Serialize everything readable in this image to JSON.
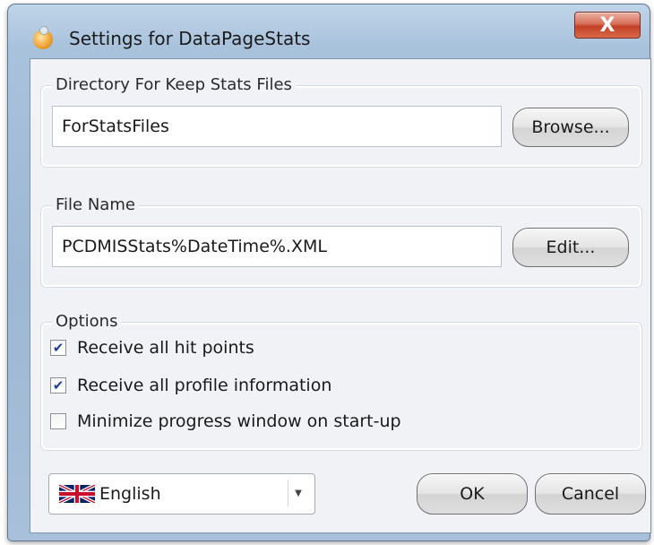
{
  "window": {
    "title": "Settings for DataPageStats",
    "close_glyph": "X"
  },
  "directory_group": {
    "legend": "Directory For Keep Stats Files",
    "value": "ForStatsFiles",
    "button_label": "Browse..."
  },
  "filename_group": {
    "legend": "File Name",
    "value": "PCDMISStats%DateTime%.XML",
    "button_label": "Edit..."
  },
  "options_group": {
    "legend": "Options",
    "items": [
      {
        "label": "Receive all hit points",
        "checked": true
      },
      {
        "label": "Receive all profile information",
        "checked": true
      },
      {
        "label": "Minimize progress window on start-up",
        "checked": false
      }
    ]
  },
  "footer": {
    "language_selected": "English",
    "flag_icon": "uk-flag-icon",
    "ok_label": "OK",
    "cancel_label": "Cancel"
  },
  "colors": {
    "close_button": "#c24026",
    "checkmark": "#21418f",
    "frame": "#a9c2dc"
  }
}
